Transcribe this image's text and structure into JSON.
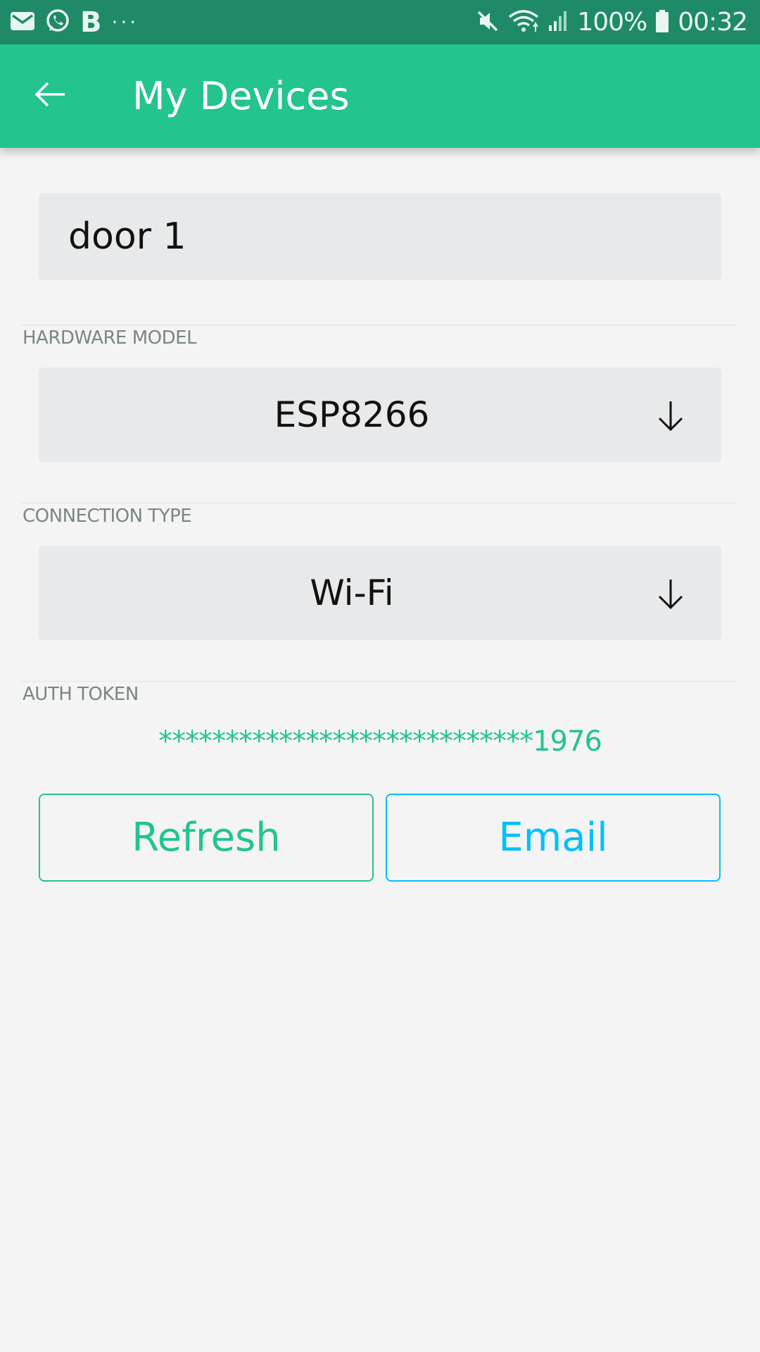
{
  "status_bar": {
    "notification_icons": [
      "mail-icon",
      "whatsapp-icon",
      "blynk-b-icon"
    ],
    "more_indicator": "···",
    "battery_percent": "100%",
    "time": "00:32",
    "system_icons": [
      "mute-icon",
      "wifi-icon",
      "signal-icon",
      "battery-icon"
    ]
  },
  "app_bar": {
    "title": "My Devices",
    "back_icon": "arrow-left-icon"
  },
  "device": {
    "name": "door 1"
  },
  "hardware_model": {
    "label": "HARDWARE MODEL",
    "value": "ESP8266"
  },
  "connection_type": {
    "label": "CONNECTION TYPE",
    "value": "Wi-Fi"
  },
  "auth_token": {
    "label": "AUTH TOKEN",
    "value": "****************************1976"
  },
  "buttons": {
    "refresh": "Refresh",
    "email": "Email"
  },
  "colors": {
    "status_bar": "#1e8a67",
    "app_bar": "#23c48d",
    "accent_green": "#23c48d",
    "accent_blue": "#04c0f8",
    "background": "#f4f4f5"
  }
}
